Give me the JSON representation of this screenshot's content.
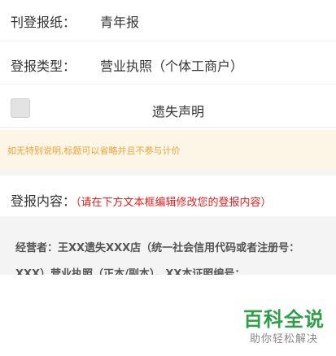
{
  "form": {
    "publication": {
      "label": "刊登报纸：",
      "value": "青年报"
    },
    "type": {
      "label": "登报类型：",
      "value": "营业执照（个体工商户）"
    },
    "lost_statement": {
      "label": "遗失声明",
      "checked": false
    },
    "hint": "如无特别说明,标题可以省略并且不参与计价",
    "content": {
      "label": "登报内容：",
      "hint": "（请在下方文本框编辑修改您的登报内容）",
      "text": "经营者：王XX遗失XXX店（统一社会信用代码或者注册号：XXX）营业执照（正本/副本），XX本证照编号："
    }
  },
  "watermark": {
    "title": "百科全说",
    "subtitle": "助你轻松解决"
  },
  "colors": {
    "hint_text": "#f0a13a",
    "hint_bg": "#fdf6e6",
    "red_hint": "#e02020",
    "brand_green": "#2e9e4a"
  }
}
